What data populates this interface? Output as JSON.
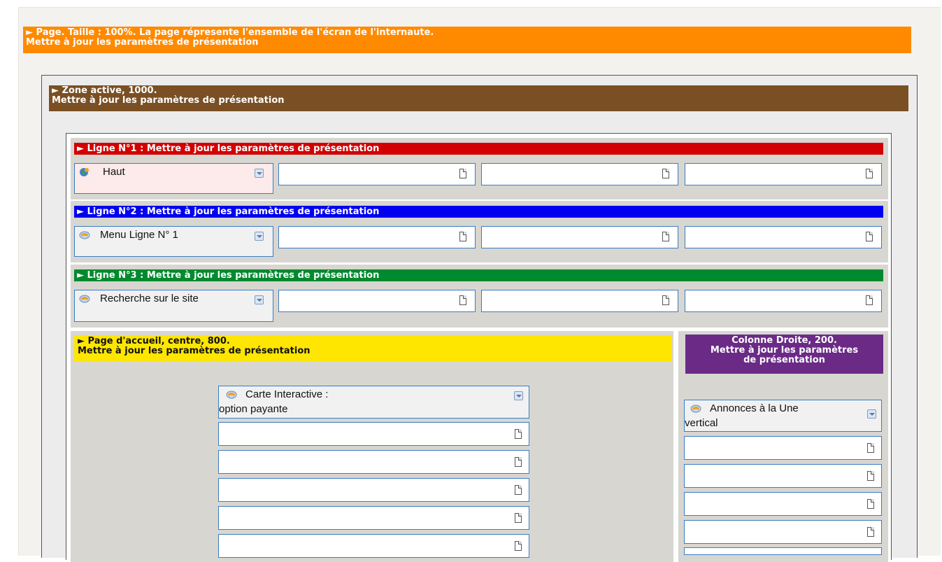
{
  "page_bar": {
    "line1": "► Page. Taille : 100%. La page répresente l'ensemble de l'écran de l'internaute.",
    "line2": "Mettre à jour les paramètres de présentation",
    "color": "#ff8a00"
  },
  "zone_bar": {
    "line1": "► Zone active, 1000.",
    "line2": "Mettre à jour les paramètres de présentation",
    "color": "#7a4f23"
  },
  "rows": [
    {
      "title": "► Ligne N°1 : Mettre à jour les paramètres de présentation",
      "color": "#d20000",
      "module": "Haut",
      "icon": "globe-icon"
    },
    {
      "title": "► Ligne N°2 : Mettre à jour les paramètres de présentation",
      "color": "#0000f0",
      "module": "Menu Ligne N° 1",
      "icon": "module-icon"
    },
    {
      "title": "► Ligne N°3 : Mettre à jour les paramètres de présentation",
      "color": "#008a2e",
      "module": "Recherche sur le site",
      "icon": "module-icon"
    }
  ],
  "center": {
    "line1": "► Page d'accueil, centre, 800.",
    "line2": "Mettre à jour les paramètres de présentation",
    "color": "#ffe600",
    "module_line1": "Carte Interactive :",
    "module_line2": "option payante"
  },
  "right": {
    "line1": "Colonne Droite, 200.",
    "line2": "Mettre à jour les paramètres",
    "line3": "de présentation",
    "color": "#6a2a86",
    "module_line1": "Annonces à la Une",
    "module_line2": "vertical"
  }
}
